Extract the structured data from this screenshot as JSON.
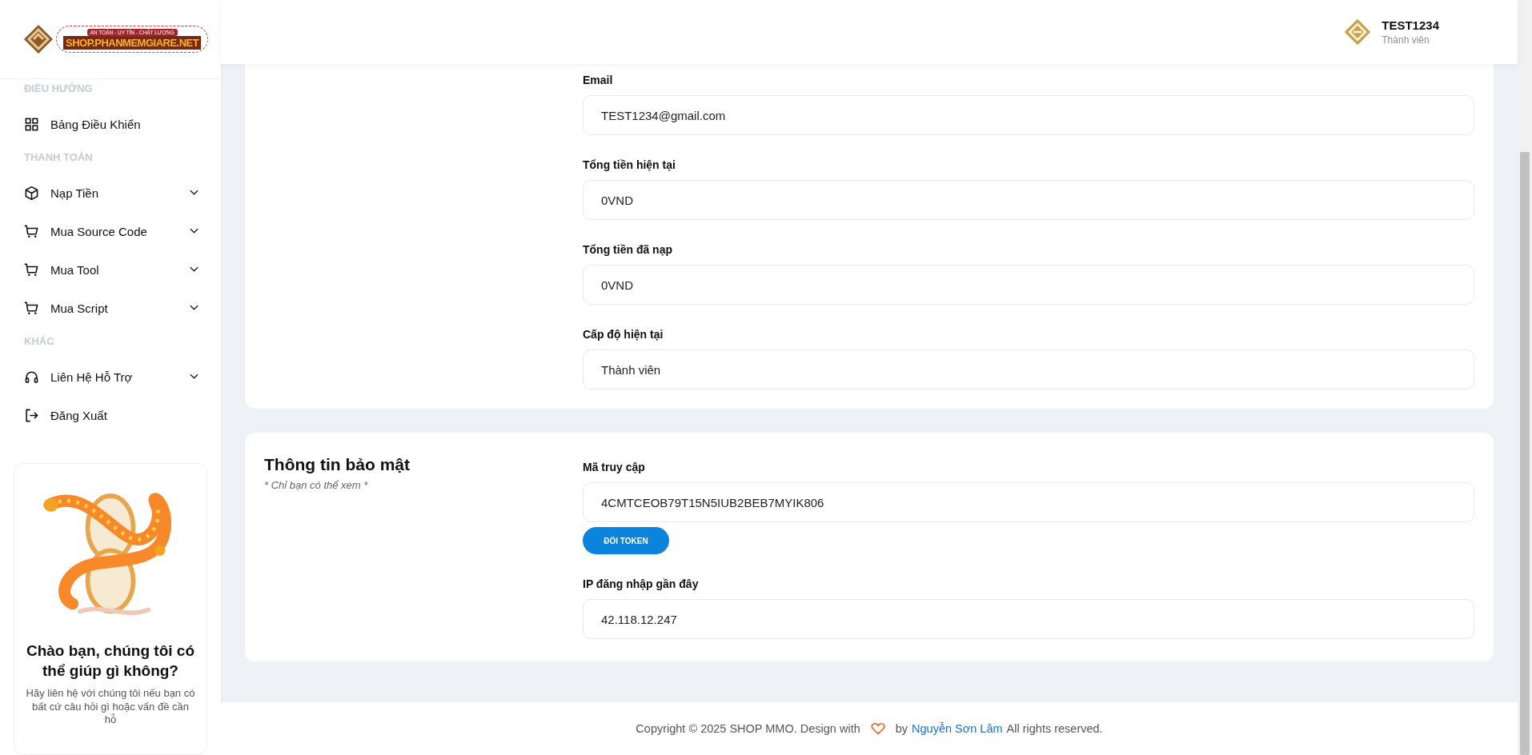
{
  "logo": {
    "tagline": "AN TOÀN - UY TÍN - CHẤT LƯỢNG",
    "name": "SHOP.PHANMEMGIARE.NET"
  },
  "sidebar": {
    "sections": [
      {
        "title": "ĐIỀU HƯỚNG",
        "items": [
          {
            "label": "Bảng Điều Khiển",
            "kind": "link"
          }
        ]
      },
      {
        "title": "THANH TOÁN",
        "items": [
          {
            "label": "Nạp Tiền",
            "kind": "dropdown",
            "expanded": false
          },
          {
            "label": "Mua Source Code",
            "kind": "dropdown",
            "expanded": false
          },
          {
            "label": "Mua Tool",
            "kind": "dropdown",
            "expanded": false
          },
          {
            "label": "Mua Script",
            "kind": "dropdown",
            "expanded": false
          }
        ]
      },
      {
        "title": "KHÁC",
        "items": [
          {
            "label": "Liên Hệ Hỗ Trợ",
            "kind": "dropdown",
            "expanded": false
          },
          {
            "label": "Đăng Xuất",
            "kind": "link"
          }
        ]
      }
    ]
  },
  "help_card": {
    "title": "Chào bạn, chúng tôi có thể giúp gì không?",
    "text": "Hãy liên hệ với chúng tôi nếu bạn có bất cứ câu hỏi gì hoặc vấn đề cần hỗ"
  },
  "user": {
    "name": "TEST1234",
    "role": "Thành viên"
  },
  "profile_card": {
    "fields": [
      {
        "label": "Email",
        "value": "TEST1234@gmail.com"
      },
      {
        "label": "Tổng tiền hiện tại",
        "value": "0VND"
      },
      {
        "label": "Tổng tiền đã nạp",
        "value": "0VND"
      },
      {
        "label": "Cấp độ hiện tại",
        "value": "Thành viên"
      }
    ]
  },
  "security_card": {
    "title": "Thông tin bảo mật",
    "note": "* Chỉ bạn có thể xem *",
    "fields": [
      {
        "label": "Mã truy cập",
        "value": "4CMTCEOB79T15N5IUB2BEB7MYIK806",
        "button": "ĐỔI TOKEN"
      },
      {
        "label": "IP đăng nhập gần đây",
        "value": "42.118.12.247"
      }
    ]
  },
  "footer": {
    "text": "Copyright © 2025 SHOP MMO. Design with",
    "by": "by",
    "author": "Nguyễn Sơn Lâm",
    "rights": "All rights reserved."
  }
}
